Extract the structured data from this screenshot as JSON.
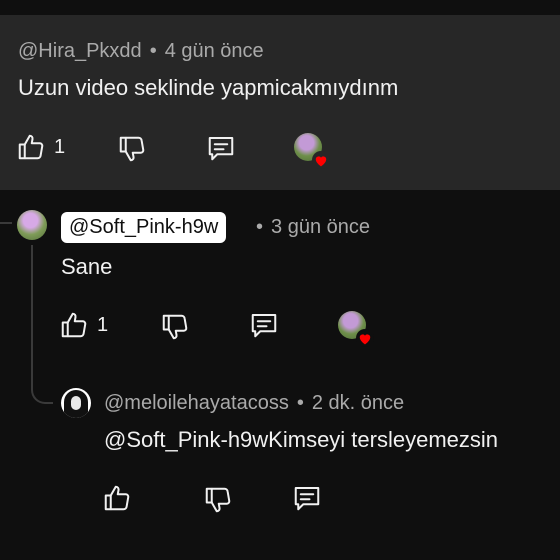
{
  "comments": [
    {
      "handle": "@Hira_Pkxdd",
      "separator": "•",
      "time": "4 gün önce",
      "text": "Uzun video seklinde yapmicakmıydınm",
      "likes": "1"
    },
    {
      "handle": "@Soft_Pink-h9w",
      "separator": "•",
      "time": "3 gün önce",
      "text": "Sane",
      "likes": "1"
    },
    {
      "handle": "@meloilehayatacoss",
      "separator": "•",
      "time": "2 dk. önce",
      "text": "@Soft_Pink-h9wKimseyi tersleyemezsin"
    }
  ],
  "icons": {
    "like": "thumbs-up-icon",
    "dislike": "thumbs-down-icon",
    "reply": "reply-icon",
    "heart": "heart-icon"
  },
  "colors": {
    "background": "#0f0f0f",
    "highlighted_background": "#272727",
    "meta_text": "#aaaaaa",
    "heart": "#ff0000"
  }
}
